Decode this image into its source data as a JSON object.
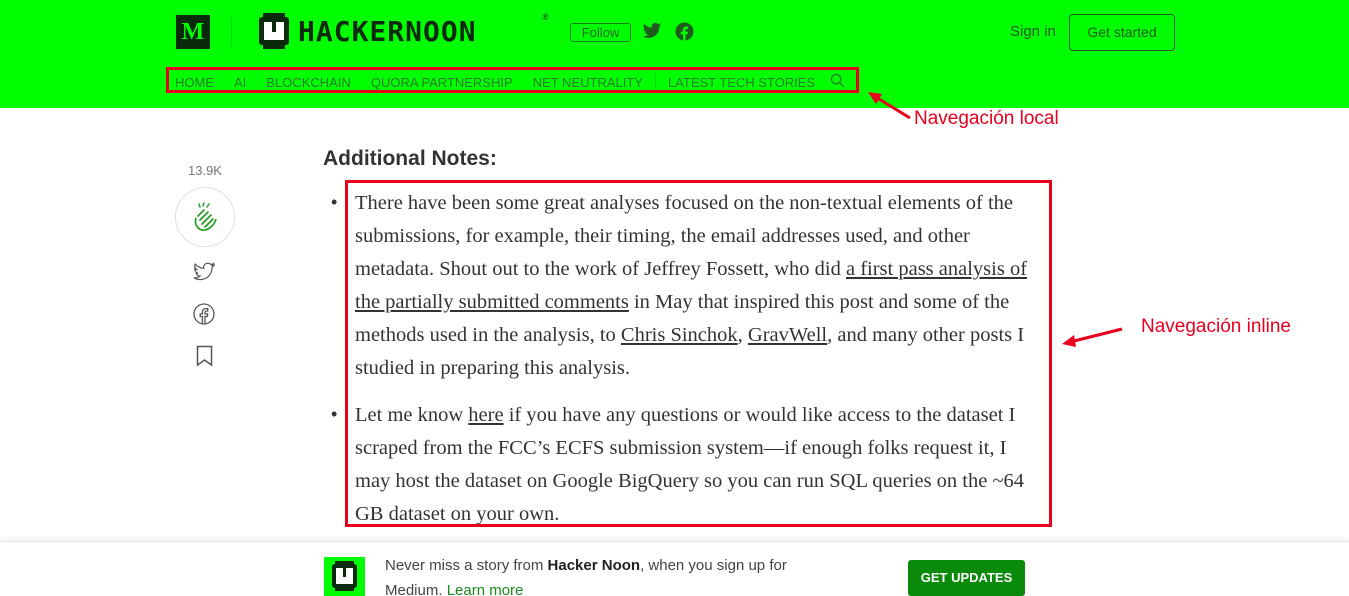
{
  "header": {
    "medium_logo": "M",
    "brand": "HACKERNOON",
    "brand_reg": "®",
    "follow_label": "Follow",
    "signin_label": "Sign in",
    "get_started_label": "Get started",
    "colors": {
      "header_bg": "#00ff00",
      "accent": "#0b2a0b"
    }
  },
  "nav": {
    "items": [
      "HOME",
      "AI",
      "BLOCKCHAIN",
      "QUORA PARTNERSHIP",
      "NET NEUTRALITY",
      "LATEST TECH STORIES"
    ],
    "search_icon": "search-icon"
  },
  "annotations": {
    "local": "Navegación local",
    "inline": "Navegación inline",
    "color": "#e8001c"
  },
  "rail": {
    "clap_count": "13.9K",
    "icons": [
      "clap-icon",
      "twitter-icon",
      "facebook-icon",
      "bookmark-icon"
    ]
  },
  "article": {
    "heading": "Additional Notes:",
    "p1": {
      "t1": "There have been some great analyses focused on the non-textual elements of the submissions, for example, their timing, the email addresses used, and other metadata. Shout out to the work of Jeffrey Fossett, who did ",
      "link1": "a first pass analysis of the partially submitted comments",
      "t2": " in May that inspired this post and some of the methods used in the analysis, to ",
      "link2": "Chris Sinchok",
      "t3": ", ",
      "link3": "GravWell",
      "t4": ", and many other posts I studied in preparing this analysis."
    },
    "p2": {
      "t1": "Let me know ",
      "link1": "here",
      "t2": " if you have any questions or would like access to the dataset I scraped from the FCC’s ECFS submission system—if enough folks request it, I may host the dataset on Google BigQuery so you can run SQL queries on the ~64 GB dataset on your own."
    }
  },
  "banner": {
    "t1": "Never miss a story from ",
    "publication": "Hacker Noon",
    "t2": ", when you sign up for Medium. ",
    "learn_more": "Learn more",
    "cta": "GET UPDATES"
  }
}
